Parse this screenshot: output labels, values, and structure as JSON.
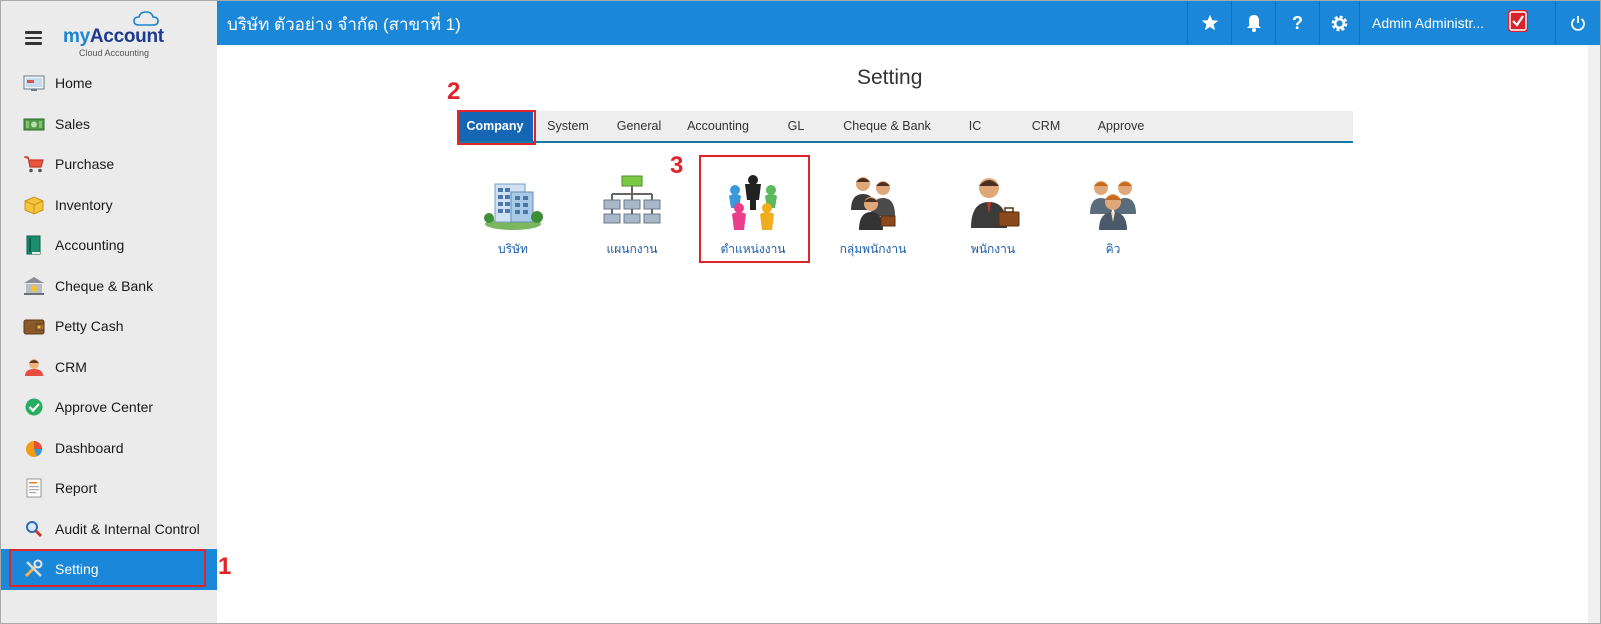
{
  "brand": {
    "name_prefix": "my",
    "name_main": "Account",
    "subtitle": "Cloud Accounting"
  },
  "sidebar": {
    "items": [
      {
        "label": "Home",
        "icon": "home-icon",
        "active": false
      },
      {
        "label": "Sales",
        "icon": "sales-icon",
        "active": false
      },
      {
        "label": "Purchase",
        "icon": "purchase-cart-icon",
        "active": false
      },
      {
        "label": "Inventory",
        "icon": "inventory-box-icon",
        "active": false
      },
      {
        "label": "Accounting",
        "icon": "accounting-book-icon",
        "active": false
      },
      {
        "label": "Cheque & Bank",
        "icon": "bank-icon",
        "active": false
      },
      {
        "label": "Petty Cash",
        "icon": "wallet-icon",
        "active": false
      },
      {
        "label": "CRM",
        "icon": "crm-person-icon",
        "active": false
      },
      {
        "label": "Approve Center",
        "icon": "approve-check-icon",
        "active": false
      },
      {
        "label": "Dashboard",
        "icon": "dashboard-pie-icon",
        "active": false
      },
      {
        "label": "Report",
        "icon": "report-icon",
        "active": false
      },
      {
        "label": "Audit & Internal Control",
        "icon": "audit-search-icon",
        "active": false
      },
      {
        "label": "Setting",
        "icon": "setting-tools-icon",
        "active": true
      }
    ]
  },
  "topbar": {
    "company": "บริษัท ตัวอย่าง จำกัด (สาขาที่ 1)",
    "user": "Admin Administr...",
    "icons": [
      "star-icon",
      "bell-icon",
      "help-icon",
      "gear-icon",
      "power-icon"
    ]
  },
  "main": {
    "title": "Setting",
    "tabs": [
      {
        "label": "Company",
        "active": true
      },
      {
        "label": "System",
        "active": false
      },
      {
        "label": "General",
        "active": false
      },
      {
        "label": "Accounting",
        "active": false
      },
      {
        "label": "GL",
        "active": false
      },
      {
        "label": "Cheque & Bank",
        "active": false
      },
      {
        "label": "IC",
        "active": false
      },
      {
        "label": "CRM",
        "active": false
      },
      {
        "label": "Approve",
        "active": false
      }
    ],
    "apps": [
      {
        "label": "บริษัท",
        "icon": "company-building-icon"
      },
      {
        "label": "แผนกงาน",
        "icon": "department-org-chart-icon"
      },
      {
        "label": "ตำแหน่งงาน",
        "icon": "position-people-icon"
      },
      {
        "label": "กลุ่มพนักงาน",
        "icon": "employee-group-icon"
      },
      {
        "label": "พนักงาน",
        "icon": "employee-icon"
      },
      {
        "label": "คิว",
        "icon": "queue-icon"
      }
    ]
  },
  "annotations": {
    "step1": "1",
    "step2": "2",
    "step3": "3"
  },
  "colors": {
    "accent": "#1a87d8",
    "active_tab": "#1566b5",
    "highlight": "#e0242a",
    "sidebar_bg": "#ebebeb"
  }
}
